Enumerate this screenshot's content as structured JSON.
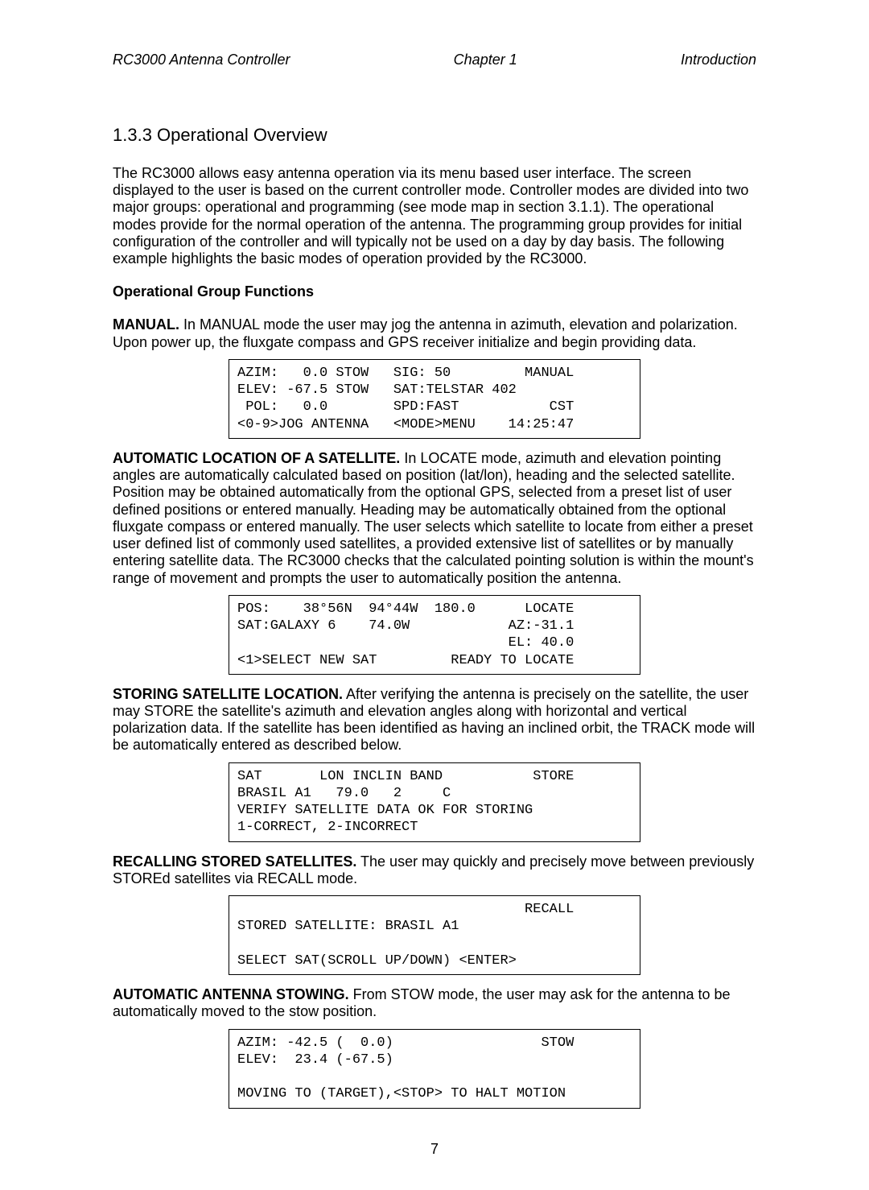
{
  "header": {
    "left": "RC3000 Antenna Controller",
    "center": "Chapter 1",
    "right": "Introduction"
  },
  "section_title": "1.3.3 Operational Overview",
  "intro": "The RC3000 allows easy antenna operation via its menu based user interface.  The screen displayed to the user is based on the current controller mode.  Controller modes are divided into two major groups: operational and programming (see mode map in section 3.1.1).  The operational modes provide for the normal operation of the antenna.  The programming group provides for initial configuration of the controller and will typically not be used on a day by day basis.  The following example highlights the basic modes of operation provided by the RC3000.",
  "subhead": "Operational Group Functions",
  "feat_manual_lead": "MANUAL.",
  "feat_manual_body": " In MANUAL mode the user may jog the antenna in azimuth, elevation and polarization.  Upon power up, the fluxgate compass and GPS receiver initialize and begin providing data.",
  "scr_manual": "AZIM:   0.0 STOW   SIG: 50         MANUAL\nELEV: -67.5 STOW   SAT:TELSTAR 402\n POL:   0.0        SPD:FAST           CST\n<0-9>JOG ANTENNA   <MODE>MENU    14:25:47",
  "feat_locate_lead": "AUTOMATIC LOCATION OF A SATELLITE.",
  "feat_locate_body": "  In LOCATE mode, azimuth and elevation pointing angles are automatically calculated based on position (lat/lon), heading and the selected satellite.  Position may be obtained automatically from the optional GPS, selected from a preset list of user defined positions or entered manually.  Heading may be automatically obtained from the optional fluxgate compass or entered manually.  The user selects which satellite to locate from either a preset user defined list of commonly used satellites, a provided extensive list of satellites or by manually entering satellite data.  The RC3000 checks that the calculated pointing solution is within the mount's range of movement and prompts the user to automatically position the antenna.",
  "scr_locate": "POS:    38°56N  94°44W  180.0      LOCATE\nSAT:GALAXY 6    74.0W            AZ:-31.1\n                                 EL: 40.0\n<1>SELECT NEW SAT         READY TO LOCATE",
  "feat_store_lead": "STORING SATELLITE LOCATION.",
  "feat_store_body": "  After verifying the antenna is precisely on the satellite, the user may STORE the satellite's azimuth and elevation angles along with horizontal and vertical polarization data.  If the satellite has been identified as having an inclined orbit, the TRACK mode will be automatically entered as described below.",
  "scr_store": "SAT       LON INCLIN BAND           STORE\nBRASIL A1   79.0   2     C\nVERIFY SATELLITE DATA OK FOR STORING\n1-CORRECT, 2-INCORRECT",
  "feat_recall_lead": "RECALLING STORED SATELLITES.",
  "feat_recall_body": "  The user may quickly and precisely move between previously STOREd satellites via RECALL mode.",
  "scr_recall": "                                   RECALL\nSTORED SATELLITE: BRASIL A1\n\nSELECT SAT(SCROLL UP/DOWN) <ENTER>",
  "feat_stow_lead": "AUTOMATIC ANTENNA STOWING.",
  "feat_stow_body": "  From STOW mode, the user may ask for the antenna to be automatically moved to the stow position.",
  "scr_stow": "AZIM: -42.5 (  0.0)                  STOW\nELEV:  23.4 (-67.5)\n\nMOVING TO (TARGET),<STOP> TO HALT MOTION",
  "page_number": "7"
}
